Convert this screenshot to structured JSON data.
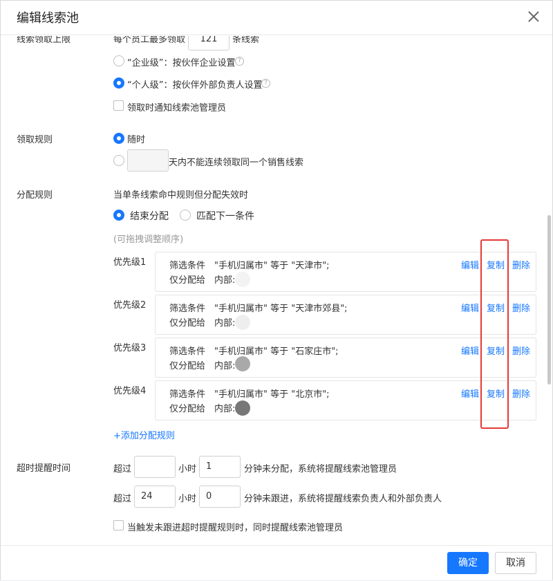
{
  "dialog": {
    "title": "编辑线索池"
  },
  "limit": {
    "label": "线索领取上限",
    "prefix": "每个员工最多领取",
    "value": "121",
    "suffix": "条线索",
    "options": [
      {
        "label": "“企业级”：按伙伴企业设置",
        "selected": false
      },
      {
        "label": "“个人级”：按伙伴外部负责人设置",
        "selected": true
      }
    ],
    "notify_label": "领取时通知线索池管理员"
  },
  "claim_rule": {
    "label": "领取规则",
    "anytime_label": "随时",
    "days_value": "",
    "days_suffix": "天内不能连续领取同一个销售线索"
  },
  "assign_rule": {
    "label": "分配规则",
    "desc": "当单条线索命中规则但分配失效时",
    "options": [
      {
        "label": "结束分配",
        "selected": true
      },
      {
        "label": "匹配下一条件",
        "selected": false
      }
    ],
    "drag_hint": "(可拖拽调整顺序)",
    "filter_key": "筛选条件",
    "assign_key": "仅分配给",
    "internal_label": "内部:",
    "actions": {
      "edit": "编辑",
      "copy": "复制",
      "delete": "删除"
    },
    "priorities": [
      {
        "label": "优先级1",
        "condition": "\"手机归属市\" 等于 \"天津市\";"
      },
      {
        "label": "优先级2",
        "condition": "\"手机归属市\" 等于 \"天津市郊县\";"
      },
      {
        "label": "优先级3",
        "condition": "\"手机归属市\" 等于 \"石家庄市\";"
      },
      {
        "label": "优先级4",
        "condition": "\"手机归属市\" 等于 \"北京市\";"
      }
    ],
    "add_label": "+添加分配规则"
  },
  "timeout": {
    "label": "超时提醒时间",
    "row1": {
      "prefix": "超过",
      "hours": "",
      "hours_unit": "小时",
      "minutes": "1",
      "suffix": "分钟未分配，系统将提醒线索池管理员"
    },
    "row2": {
      "prefix": "超过",
      "hours": "24",
      "hours_unit": "小时",
      "minutes": "0",
      "suffix": "分钟未跟进，系统将提醒线索负责人和外部负责人"
    },
    "notify_label": "当触发未跟进超时提醒规则时，同时提醒线索池管理员"
  },
  "footer": {
    "confirm": "确定",
    "cancel": "取消"
  },
  "colors": {
    "accent": "#1677ff",
    "highlight": "#e53935"
  }
}
